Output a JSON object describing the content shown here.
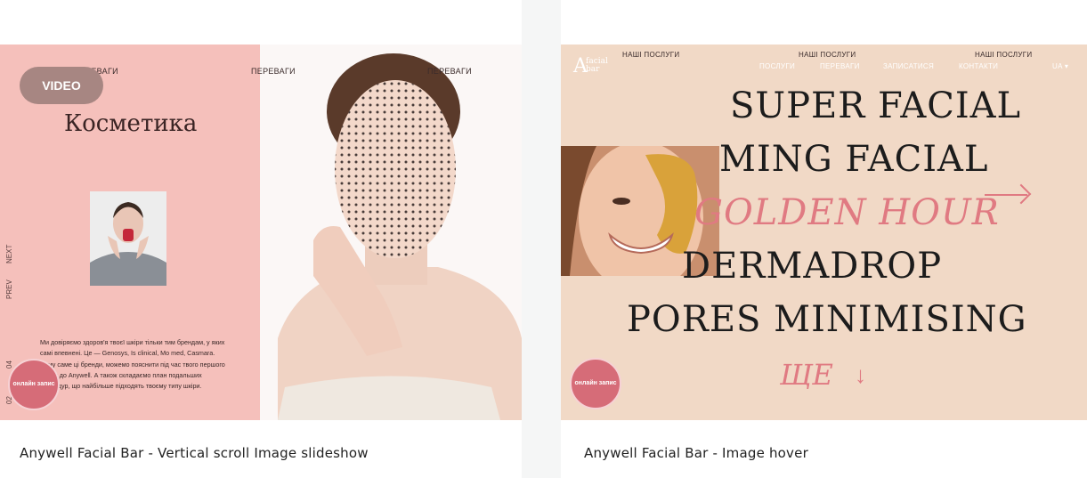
{
  "cards": [
    {
      "caption": "Anywell Facial Bar - Vertical scroll Image slideshow",
      "preview": {
        "nav": [
          "ПЕРЕВАГИ",
          "ПЕРЕВАГИ",
          "ПЕРЕВАГИ"
        ],
        "video_label": "VIDEO",
        "title": "Косметика",
        "next_label": "NEXT",
        "prev_label": "PREV",
        "counter_top": "04",
        "counter_bottom": "02",
        "paragraph": "Ми довіряємо здоров'я твоєї шкіри тільки тим брендам, у яких самі впевнені. Це — Genosys, Is clinical, Mo med, Casmara. Чому саме ці бренди, можемо пояснити під час твого першого візиту до Anywell. А також складаємо план подальших процедур, що найбільше підходять твоєму типу шкіри.",
        "booking_label": "онлайн запис"
      }
    },
    {
      "caption": "Anywell Facial Bar - Image hover",
      "preview": {
        "logo_letter": "A",
        "logo_word1": "facial",
        "logo_word2": "bar",
        "top_nav": [
          "НАШІ ПОСЛУГИ",
          "НАШІ ПОСЛУГИ",
          "НАШІ ПОСЛУГИ"
        ],
        "menu": [
          "ПОСЛУГИ",
          "ПЕРЕВАГИ",
          "ЗАПИСАТИСЯ",
          "КОНТАКТИ"
        ],
        "lang": "UA",
        "services": [
          "SUPER FACIAL",
          "MING FACIAL",
          "GOLDEN HOUR",
          "DERMADROP",
          "PORES MINIMISING"
        ],
        "more_label": "ЩЕ",
        "booking_label": "онлайн запис"
      }
    }
  ],
  "colors": {
    "page_bg": "#f5f6f6",
    "pink_panel": "#f5c0bb",
    "peach_panel": "#f1d9c6",
    "accent": "#e07a82",
    "video_button": "#a78682"
  }
}
